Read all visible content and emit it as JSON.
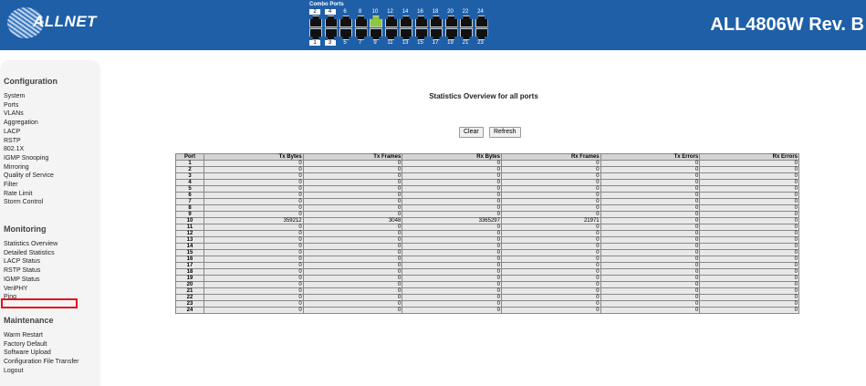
{
  "header": {
    "logo_text": "ALLNET",
    "model": "ALL4806W Rev. B",
    "combo_label": "Combo Ports",
    "top_ports": [
      "2",
      "4",
      "6",
      "8",
      "10",
      "12",
      "14",
      "16",
      "18",
      "20",
      "22",
      "24"
    ],
    "bottom_ports": [
      "1",
      "3",
      "5",
      "7",
      "9",
      "11",
      "13",
      "15",
      "17",
      "19",
      "21",
      "23"
    ],
    "active_port": "10",
    "colors": {
      "header_bg": "#1f5fa8",
      "active_port": "#8dc63f"
    }
  },
  "sidebar": {
    "configuration": {
      "heading": "Configuration",
      "items": [
        "System",
        "Ports",
        "VLANs",
        "Aggregation",
        "LACP",
        "RSTP",
        "802.1X",
        "IGMP Snooping",
        "Mirroring",
        "Quality of Service",
        "Filter",
        "Rate Limit",
        "Storm Control"
      ]
    },
    "monitoring": {
      "heading": "Monitoring",
      "items": [
        "Statistics Overview",
        "Detailed Statistics",
        "LACP Status",
        "RSTP Status",
        "IGMP Status",
        "VeriPHY",
        "Ping"
      ],
      "selected": "Statistics Overview"
    },
    "maintenance": {
      "heading": "Maintenance",
      "items": [
        "Warm Restart",
        "Factory Default",
        "Software Upload",
        "Configuration File Transfer",
        "Logout"
      ]
    },
    "colors": {
      "selected_border": "#e1141b"
    }
  },
  "main": {
    "title": "Statistics Overview for all ports",
    "buttons": {
      "clear": "Clear",
      "refresh": "Refresh"
    },
    "columns": [
      "Port",
      "Tx Bytes",
      "Tx Frames",
      "Rx Bytes",
      "Rx Frames",
      "Tx Errors",
      "Rx Errors"
    ],
    "rows": [
      [
        "1",
        "0",
        "0",
        "0",
        "0",
        "0",
        "0"
      ],
      [
        "2",
        "0",
        "0",
        "0",
        "0",
        "0",
        "0"
      ],
      [
        "3",
        "0",
        "0",
        "0",
        "0",
        "0",
        "0"
      ],
      [
        "4",
        "0",
        "0",
        "0",
        "0",
        "0",
        "0"
      ],
      [
        "5",
        "0",
        "0",
        "0",
        "0",
        "0",
        "0"
      ],
      [
        "6",
        "0",
        "0",
        "0",
        "0",
        "0",
        "0"
      ],
      [
        "7",
        "0",
        "0",
        "0",
        "0",
        "0",
        "0"
      ],
      [
        "8",
        "0",
        "0",
        "0",
        "0",
        "0",
        "0"
      ],
      [
        "9",
        "0",
        "0",
        "0",
        "0",
        "0",
        "0"
      ],
      [
        "10",
        "359212",
        "3048",
        "3365297",
        "21971",
        "0",
        "0"
      ],
      [
        "11",
        "0",
        "0",
        "0",
        "0",
        "0",
        "0"
      ],
      [
        "12",
        "0",
        "0",
        "0",
        "0",
        "0",
        "0"
      ],
      [
        "13",
        "0",
        "0",
        "0",
        "0",
        "0",
        "0"
      ],
      [
        "14",
        "0",
        "0",
        "0",
        "0",
        "0",
        "0"
      ],
      [
        "15",
        "0",
        "0",
        "0",
        "0",
        "0",
        "0"
      ],
      [
        "16",
        "0",
        "0",
        "0",
        "0",
        "0",
        "0"
      ],
      [
        "17",
        "0",
        "0",
        "0",
        "0",
        "0",
        "0"
      ],
      [
        "18",
        "0",
        "0",
        "0",
        "0",
        "0",
        "0"
      ],
      [
        "19",
        "0",
        "0",
        "0",
        "0",
        "0",
        "0"
      ],
      [
        "20",
        "0",
        "0",
        "0",
        "0",
        "0",
        "0"
      ],
      [
        "21",
        "0",
        "0",
        "0",
        "0",
        "0",
        "0"
      ],
      [
        "22",
        "0",
        "0",
        "0",
        "0",
        "0",
        "0"
      ],
      [
        "23",
        "0",
        "0",
        "0",
        "0",
        "0",
        "0"
      ],
      [
        "24",
        "0",
        "0",
        "0",
        "0",
        "0",
        "0"
      ]
    ]
  }
}
